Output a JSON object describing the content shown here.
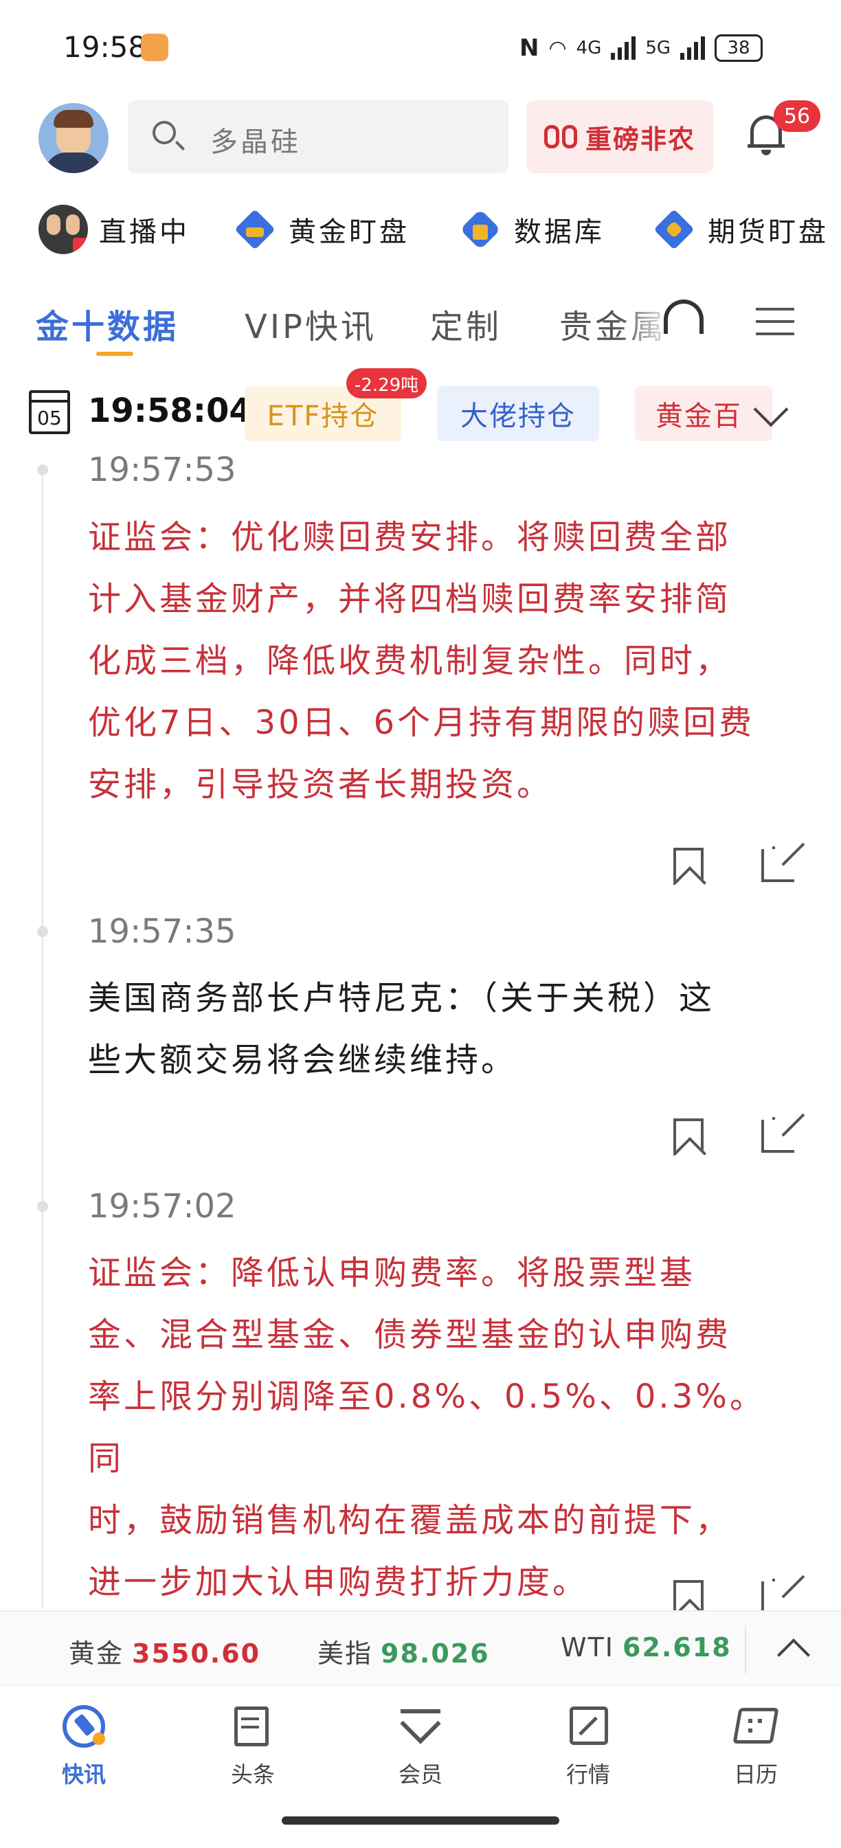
{
  "status_bar": {
    "time": "19:58",
    "network_a": "4G",
    "network_b": "5G",
    "battery": "38"
  },
  "header": {
    "search_placeholder": "多晶硅",
    "promo_label": "重磅非农",
    "notification_count": "56"
  },
  "shortcuts": [
    {
      "label": "直播中",
      "icon": "live-avatar"
    },
    {
      "label": "黄金盯盘",
      "icon": "diamond-icon"
    },
    {
      "label": "数据库",
      "icon": "cube-icon"
    },
    {
      "label": "期货盯盘",
      "icon": "diamond-icon"
    }
  ],
  "tabs": [
    "金十数据",
    "VIP快讯",
    "定制",
    "贵金属"
  ],
  "clock_row": {
    "calendar_day": "05",
    "time": "19:58:04",
    "chips": [
      "ETF持仓",
      "大佬持仓",
      "黄金百"
    ],
    "etf_badge": "-2.29吨"
  },
  "feed": [
    {
      "time": "19:57:53",
      "color": "#c8313a",
      "lines": [
        "证监会：优化赎回费安排。将赎回费全部",
        "计入基金财产，并将四档赎回费率安排简",
        "化成三档，降低收费机制复杂性。同时，",
        "优化7日、30日、6个月持有期限的赎回费",
        "安排，引导投资者长期投资。"
      ]
    },
    {
      "time": "19:57:35",
      "color": "#1c1c1c",
      "lines": [
        "美国商务部长卢特尼克：（关于关税）这",
        "些大额交易将会继续维持。"
      ]
    },
    {
      "time": "19:57:02",
      "color": "#c8313a",
      "lines": [
        "证监会：降低认申购费率。将股票型基",
        "金、混合型基金、债券型基金的认申购费",
        "率上限分别调降至0.8%、0.5%、0.3%。同",
        "时，鼓励销售机构在覆盖成本的前提下，",
        "进一步加大认申购费打折力度。"
      ]
    }
  ],
  "ticker": [
    {
      "label": "黄金",
      "value": "3550.60",
      "color": "#d12f36"
    },
    {
      "label": "美指",
      "value": "98.026",
      "color": "#3a9a5b"
    },
    {
      "label": "WTI",
      "value": "62.618",
      "color": "#3a9a5b"
    }
  ],
  "bottom_nav": [
    {
      "label": "快讯",
      "active": true
    },
    {
      "label": "头条",
      "active": false
    },
    {
      "label": "会员",
      "active": false
    },
    {
      "label": "行情",
      "active": false
    },
    {
      "label": "日历",
      "active": false
    }
  ]
}
